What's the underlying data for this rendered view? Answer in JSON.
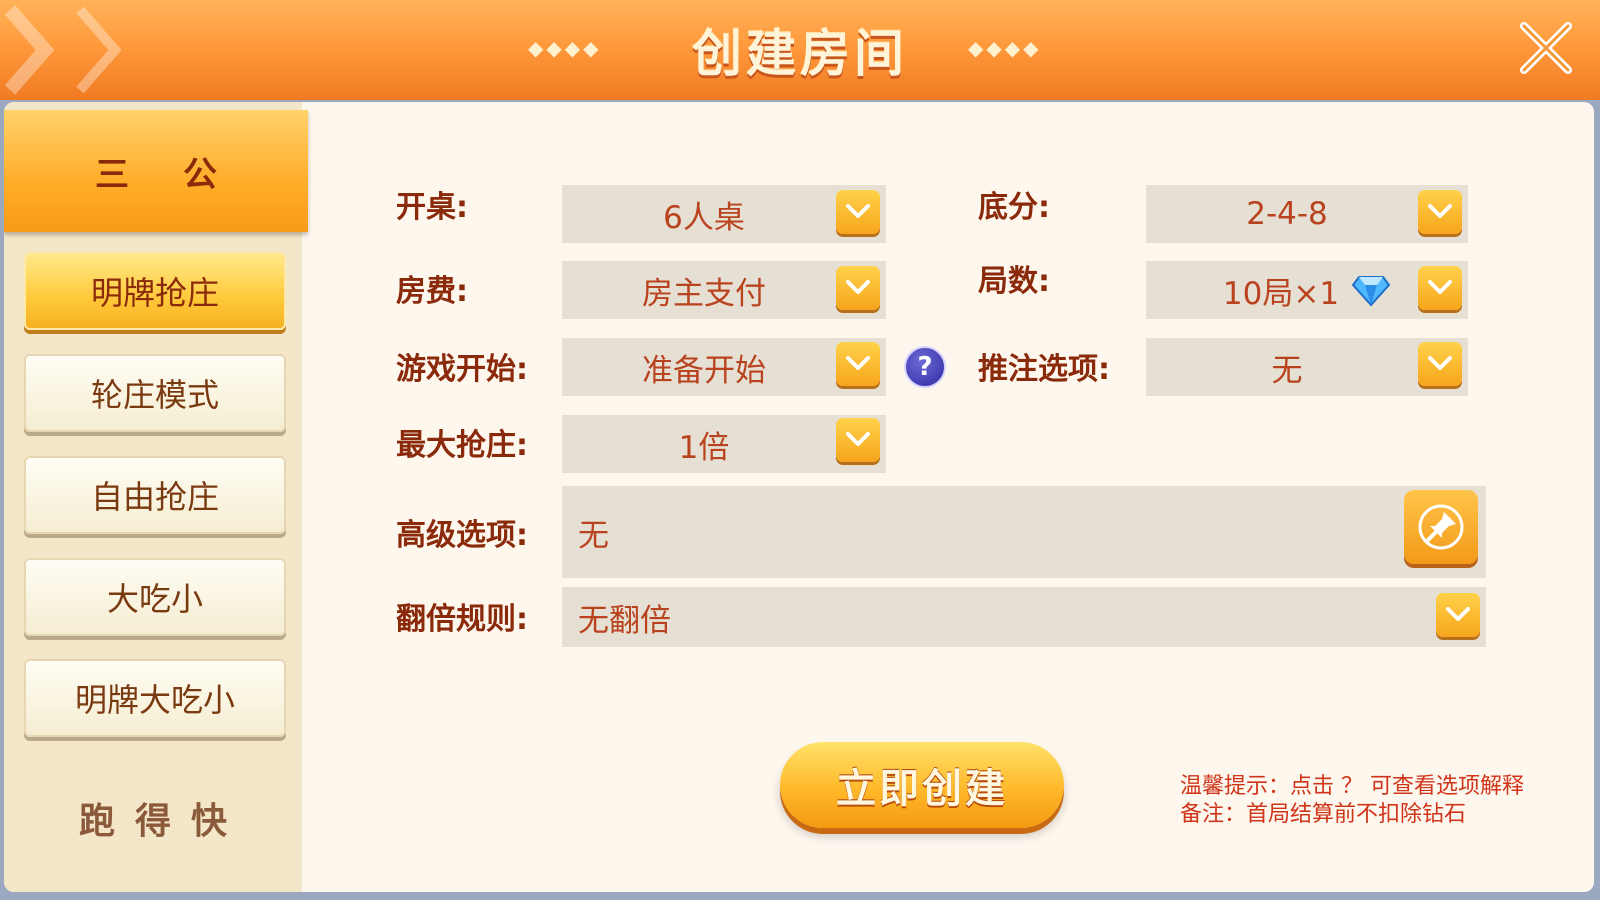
{
  "header": {
    "title": "创建房间",
    "deco_left": "◆◆◆◆",
    "deco_right": "◆◆◆◆"
  },
  "sidebar": {
    "game_title": "三公",
    "modes": [
      "明牌抢庄",
      "轮庄模式",
      "自由抢庄",
      "大吃小",
      "明牌大吃小"
    ],
    "active_index": 0,
    "other_game": "跑得快"
  },
  "form": {
    "table": {
      "label": "开桌:",
      "value": "6人桌"
    },
    "base_score": {
      "label": "底分:",
      "value": "2-4-8"
    },
    "room_fee": {
      "label": "房费:",
      "value": "房主支付"
    },
    "rounds": {
      "label": "局数:",
      "value": "10局×1"
    },
    "game_start": {
      "label": "游戏开始:",
      "value": "准备开始"
    },
    "bet_push": {
      "label": "推注选项:",
      "value": "无"
    },
    "max_bank": {
      "label": "最大抢庄:",
      "value": "1倍"
    },
    "advanced": {
      "label": "高级选项:",
      "value": "无"
    },
    "double_rule": {
      "label": "翻倍规则:",
      "value": "无翻倍"
    }
  },
  "create_button": "立即创建",
  "notes": {
    "tip": "温馨提示：点击 ？ 可查看选项解释",
    "remark": "备注：首局结算前不扣除钻石"
  },
  "colors": {
    "accent": "#f6a51c",
    "label": "#8a2a0a",
    "value": "#b8431e",
    "note": "#d0351a"
  }
}
